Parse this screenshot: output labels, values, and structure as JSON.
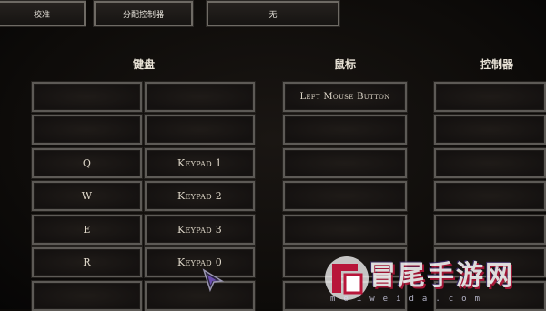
{
  "top_buttons": [
    "校准",
    "分配控制器",
    "无"
  ],
  "columns": {
    "keyboard": "键盘",
    "mouse": "鼠标",
    "controller": "控制器"
  },
  "keyboard_rows": [
    {
      "primary": "",
      "secondary": ""
    },
    {
      "primary": "",
      "secondary": ""
    },
    {
      "primary": "Q",
      "secondary": "Keypad 1"
    },
    {
      "primary": "W",
      "secondary": "Keypad 2"
    },
    {
      "primary": "E",
      "secondary": "Keypad 3"
    },
    {
      "primary": "R",
      "secondary": "Keypad 0"
    },
    {
      "primary": "",
      "secondary": ""
    }
  ],
  "mouse_rows": [
    "Left Mouse Button",
    "",
    "",
    "",
    "",
    "",
    ""
  ],
  "controller_rows": [
    "",
    "",
    "",
    "",
    "",
    "",
    ""
  ],
  "watermark": {
    "title": "冒尾手游网",
    "subtitle": "meiweida.com"
  }
}
